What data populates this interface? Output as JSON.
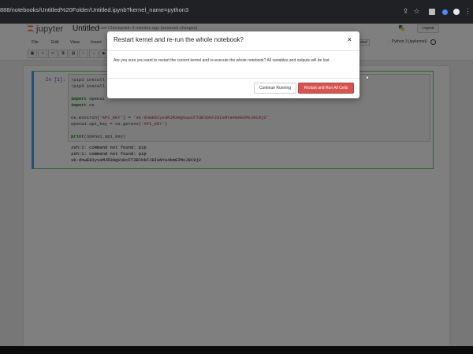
{
  "browser": {
    "url": "888/notebooks/Untitled%20Folder/Untitled.ipynb?kernel_name=python3",
    "icons": [
      "share-icon",
      "star-icon",
      "extension-icon",
      "extension-icon",
      "profile-icon",
      "menu-dots-icon"
    ]
  },
  "header": {
    "brand": "jupyter",
    "notebook_title": "Untitled",
    "checkpoint": "Last Checkpoint: 4 minutes ago  (unsaved changes)",
    "logout_label": "Logout",
    "kernel_name": "Python 3 (ipykernel)",
    "trusted_label": "Trusted"
  },
  "menu": {
    "items": [
      "File",
      "Edit",
      "View",
      "Insert"
    ]
  },
  "cell": {
    "prompt": "In [1]:",
    "code": {
      "line1": "!pip3 install openai",
      "line2": "!pip3 install os",
      "line3_kw": "import",
      "line3_rest": " openai",
      "line4_kw": "import",
      "line4_rest": " os",
      "line5_pre": "os.environ[",
      "line5_key": "'API_KEY'",
      "line5_mid": "] = ",
      "line5_val": "'sk-dnwE81yvaMJR3HgVuUcFT3BlbkFJ8IsNYa4kmGIMxJ9C9j2'",
      "line6_pre": "openai.api_key = os.getenv(",
      "line6_key": "'API_KEY'",
      "line6_post": ")",
      "line7_kw": "print",
      "line7_rest": "(openai.api_key)"
    },
    "output": {
      "line1": "zsh:1: command not found: pip",
      "line2": "zsh:1: command not found: pip",
      "line3": "sk-dnwE81yvaMJR3HgVuUcFT3BlbkFJ8IsNYa4kmGIMxJ9C9j2"
    }
  },
  "dialog": {
    "title": "Restart kernel and re-run the whole notebook?",
    "close_symbol": "×",
    "body": "Are you sure you want to restart the current kernel and re-execute the whole notebook? All variables and outputs will be lost.",
    "continue_label": "Continue Running",
    "restart_label": "Restart and Run All Cells"
  },
  "colors": {
    "restart_button": "#d9534f",
    "cell_selected_border": "#42a5f5",
    "cell_edit_border": "#66bb6a"
  }
}
